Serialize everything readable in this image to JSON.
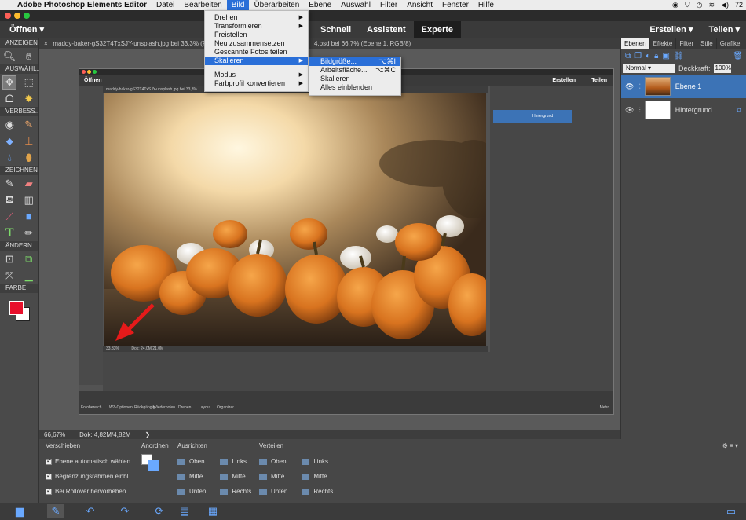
{
  "menubar": {
    "app_name": "Adobe Photoshop Elements Editor",
    "items": [
      "Datei",
      "Bearbeiten",
      "Bild",
      "Überarbeiten",
      "Ebene",
      "Auswahl",
      "Filter",
      "Ansicht",
      "Fenster",
      "Hilfe"
    ],
    "battery": "72"
  },
  "toolbar": {
    "open_label": "Öffnen",
    "modes": [
      "Schnell",
      "Assistent",
      "Experte"
    ],
    "create_label": "Erstellen",
    "share_label": "Teilen"
  },
  "tools": {
    "sections": [
      "ANZEIGEN",
      "AUSWÄHL...",
      "VERBESS...",
      "ZEICHNEN",
      "ÄNDERN",
      "FARBE"
    ]
  },
  "document": {
    "tab_title": "maddy-baker-gS32T4TxSJY-unsplash.jpg bei 33,3% (RGB/8) × Bildschirmfoto 2020-12-22 um 11.37.54.psd bei 66,7% (Ebene 1, RGB/8)",
    "tab_left": "maddy-baker-gS32T4TxSJY-unsplash.jpg bei 33,3% (RG",
    "tab_right": "4.psd bei 66,7% (Ebene 1, RGB/8)"
  },
  "status": {
    "zoom": "66,67%",
    "doc_size": "Dok: 4,82M/4,82M"
  },
  "menu_bild": {
    "items": [
      {
        "label": "Drehen",
        "submenu": true
      },
      {
        "label": "Transformieren",
        "submenu": true
      },
      {
        "label": "Freistellen",
        "submenu": false
      },
      {
        "label": "Neu zusammensetzen",
        "submenu": false
      },
      {
        "label": "Gescannte Fotos teilen",
        "submenu": false
      },
      {
        "label": "Skalieren",
        "submenu": true,
        "highlighted": true
      },
      {
        "label": "Modus",
        "submenu": true
      },
      {
        "label": "Farbprofil konvertieren",
        "submenu": true
      }
    ]
  },
  "menu_skalieren": {
    "items": [
      {
        "label": "Bildgröße...",
        "shortcut": "⌥⌘I",
        "highlighted": true
      },
      {
        "label": "Arbeitsfläche...",
        "shortcut": "⌥⌘C"
      },
      {
        "label": "Skalieren",
        "shortcut": ""
      },
      {
        "label": "Alles einblenden",
        "shortcut": ""
      }
    ]
  },
  "layers_panel": {
    "tabs": [
      "Ebenen",
      "Effekte",
      "Filter",
      "Stile",
      "Grafike"
    ],
    "blend_mode": "Normal",
    "opacity_label": "Deckkraft:",
    "opacity_value": "100%",
    "layers": [
      {
        "name": "Ebene 1",
        "selected": true
      },
      {
        "name": "Hintergrund",
        "selected": false
      }
    ]
  },
  "options": {
    "move_header": "Verschieben",
    "checkboxes": [
      "Ebene automatisch wählen",
      "Begrenzungsrahmen einbl.",
      "Bei Rollover hervorheben"
    ],
    "arrange_header": "Anordnen",
    "align_header": "Ausrichten",
    "align_col1": [
      "Oben",
      "Mitte",
      "Unten"
    ],
    "align_col2": [
      "Links",
      "Mitte",
      "Rechts"
    ],
    "distribute_header": "Verteilen",
    "dist_col1": [
      "Oben",
      "Mitte",
      "Unten"
    ],
    "dist_col2": [
      "Links",
      "Mitte",
      "Rechts"
    ]
  },
  "inner": {
    "open_label": "Öffnen",
    "tab_title": "maddy-baker-gS32T4TxSJY-unsplash.jpg bei 33,3%",
    "create_label": "Erstellen",
    "share_label": "Teilen",
    "zoom": "33,33%",
    "doc_size": "Dok: 24,0M/21,0M",
    "layer_name": "Hintergrund",
    "bottom_labels": [
      "Fotobereich",
      "WZ-Optionen",
      "Rückgängig",
      "Wiederholen",
      "Drehen",
      "Layout",
      "Organizer",
      "Mehr"
    ]
  },
  "colors": {
    "foreground": "#e8102c",
    "background": "#ffffff",
    "accent": "#2a6fd8",
    "layer_selected": "#3c73b6"
  }
}
